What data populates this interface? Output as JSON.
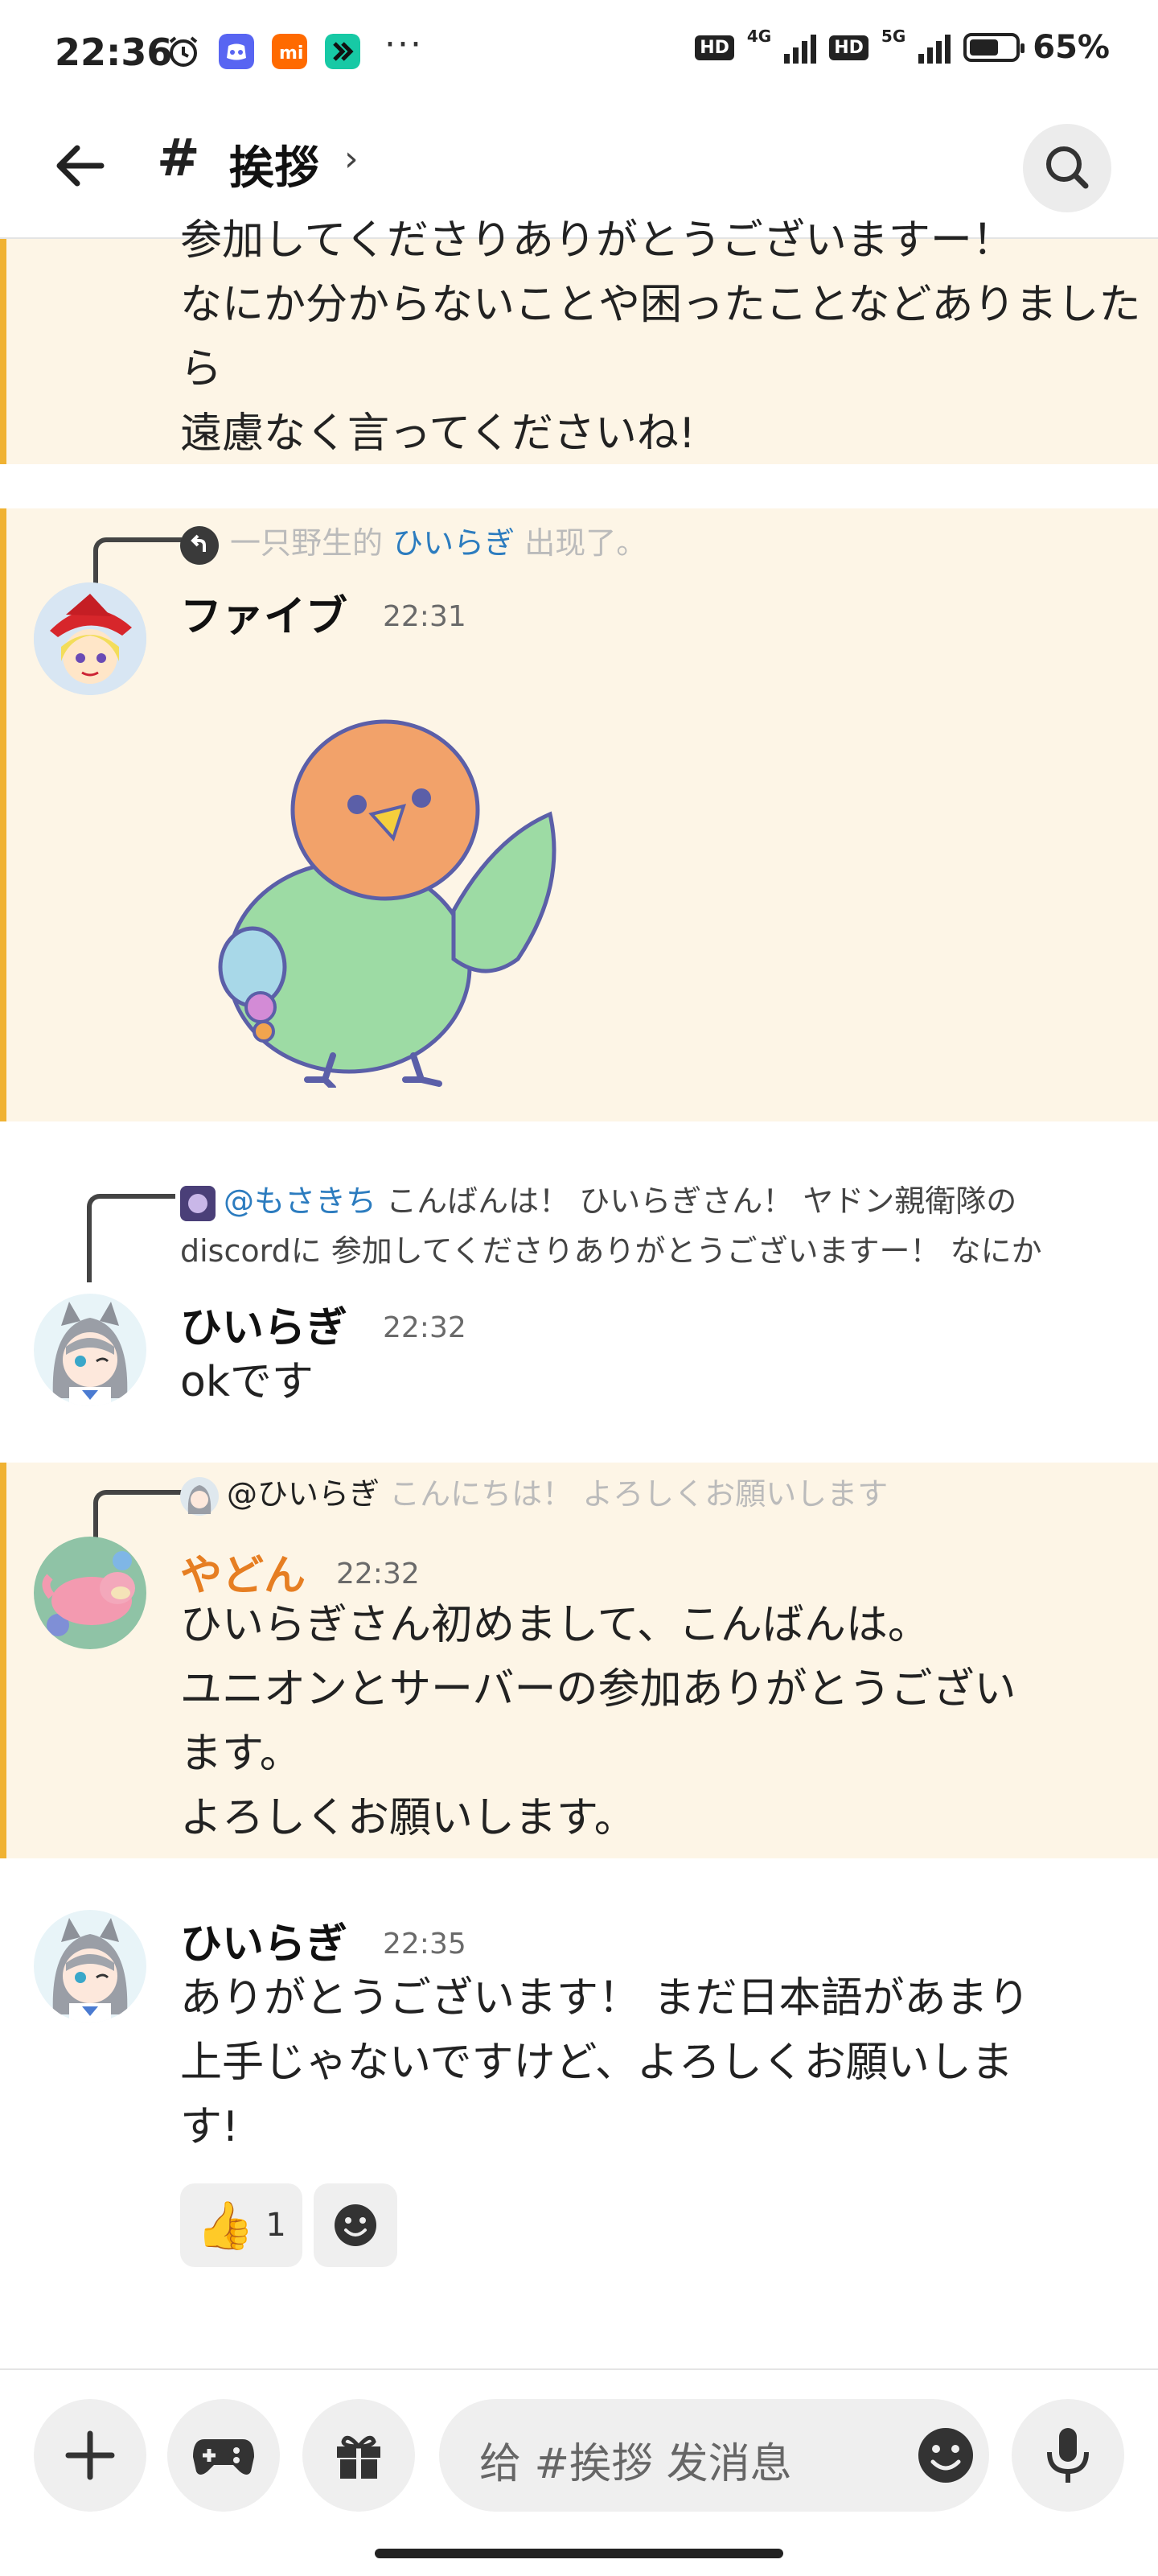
{
  "status_bar": {
    "time": "22:36",
    "dots": "···",
    "network_1": "4G",
    "network_2": "5G",
    "hd_label": "HD",
    "battery_level": 0.65,
    "battery_text": "65%"
  },
  "header": {
    "hash": "#",
    "channel_name": "挨拶",
    "chevron": "›"
  },
  "messages": [
    {
      "text": "参加してくださりありがとうございますー！\nなにか分からないことや困ったことなどありましたら\n遠慮なく言ってくださいね!"
    },
    {
      "reply": {
        "prefix": "一只野生的",
        "user": "ひいらぎ",
        "suffix": "出现了。"
      },
      "author": "ファイブ",
      "time": "22:31"
    },
    {
      "reply": {
        "mention": "@もさきち",
        "text_line1": "こんばんは！ ひいらぎさん！ ヤドン親衛隊の",
        "text_line2": "discordに 参加してくださりありがとうございますー！ なにか"
      },
      "author": "ひいらぎ",
      "time": "22:32",
      "text": "okです"
    },
    {
      "reply": {
        "user": "@ひいらぎ",
        "text": "こんにちは！ よろしくお願いします"
      },
      "author": "やどん",
      "author_color": "#e67e22",
      "time": "22:32",
      "text": "ひいらぎさん初めまして、こんばんは。\nユニオンとサーバーの参加ありがとうござい\nます。\nよろしくお願いします。"
    },
    {
      "author": "ひいらぎ",
      "time": "22:35",
      "text": "ありがとうございます！ まだ日本語があまり\n上手じゃないですけど、よろしくお願いしま\nす!",
      "reaction": {
        "emoji": "👍",
        "count": "1"
      }
    }
  ],
  "composer": {
    "placeholder": "给 #挨拶 发消息"
  },
  "colors": {
    "highlight_bg": "#fdf5e6",
    "highlight_bar": "#f0b232",
    "mention": "#2c7cbf"
  }
}
